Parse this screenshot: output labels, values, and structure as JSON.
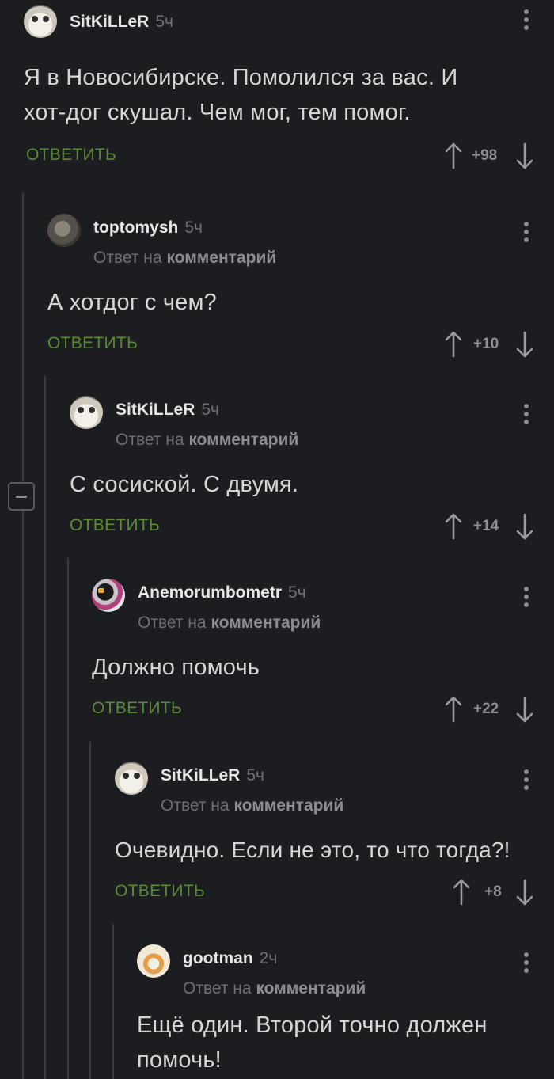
{
  "comments": [
    {
      "username": "SitKiLLeR",
      "time": "5ч",
      "reply_prefix": "",
      "reply_link": "",
      "text": "Я в Новосибирске. Помолился за вас. И хот-дог скушал. Чем мог, тем помог.",
      "reply_label": "ОТВЕТИТЬ",
      "score": "+98"
    },
    {
      "username": "toptomysh",
      "time": "5ч",
      "reply_prefix": "Ответ на",
      "reply_link": "комментарий",
      "text": "А хотдог с чем?",
      "reply_label": "ОТВЕТИТЬ",
      "score": "+10"
    },
    {
      "username": "SitKiLLeR",
      "time": "5ч",
      "reply_prefix": "Ответ на",
      "reply_link": "комментарий",
      "text": "С сосиской. С двумя.",
      "reply_label": "ОТВЕТИТЬ",
      "score": "+14"
    },
    {
      "username": "Anemorumbometr",
      "time": "5ч",
      "reply_prefix": "Ответ на",
      "reply_link": "комментарий",
      "text": "Должно помочь",
      "reply_label": "ОТВЕТИТЬ",
      "score": "+22"
    },
    {
      "username": "SitKiLLeR",
      "time": "5ч",
      "reply_prefix": "Ответ на",
      "reply_link": "комментарий",
      "text": "Очевидно. Если не это, то что тогда?!",
      "reply_label": "ОТВЕТИТЬ",
      "score": "+8"
    },
    {
      "username": "gootman",
      "time": "2ч",
      "reply_prefix": "Ответ на",
      "reply_link": "комментарий",
      "text": "Ещё один. Второй точно должен помочь!",
      "reply_label": "",
      "score": ""
    }
  ],
  "icons": {
    "upvote": "arrow-up-icon",
    "downvote": "arrow-down-icon",
    "menu": "kebab-menu-icon",
    "collapse": "collapse-thread-icon"
  },
  "colors": {
    "background": "#1c1d20",
    "reply_green": "#5b8a36",
    "muted": "#6f7075"
  }
}
